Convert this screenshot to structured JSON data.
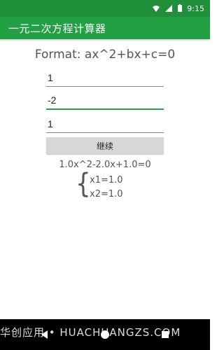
{
  "status_bar": {
    "time": "9:15"
  },
  "app_bar": {
    "title": "一元二次方程计算器"
  },
  "main": {
    "format_text": "Format: ax^2+bx+c=0",
    "inputs": {
      "a": "1",
      "b": "-2",
      "c": "1"
    },
    "button_label": "继续",
    "equation_text": "1.0x^2-2.0x+1.0=0",
    "roots": {
      "x1": "x1=1.0",
      "x2": "x2=1.0"
    }
  },
  "watermark": "华创应用 • HUACHUANGZS.COM",
  "colors": {
    "status_bar": "#1f8f3a",
    "app_bar": "#22a144",
    "accent": "#2aa14a"
  }
}
